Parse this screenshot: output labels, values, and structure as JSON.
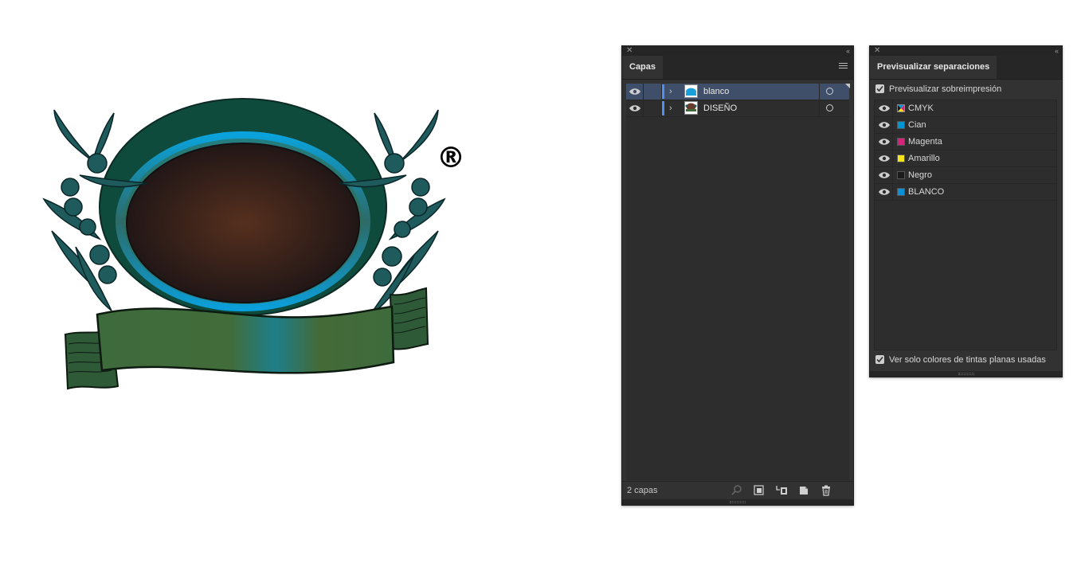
{
  "layers_panel": {
    "tab_label": "Capas",
    "layers": [
      {
        "name": "blanco",
        "selected": true,
        "thumb_color": "#1aa0d8"
      },
      {
        "name": "DISEÑO",
        "selected": false,
        "thumb_color": "#6b3a2a"
      }
    ],
    "footer_count": "2 capas",
    "layer_color": "#4d8ff5"
  },
  "separations_panel": {
    "tab_label": "Previsualizar separaciones",
    "overprint_label": "Previsualizar sobreimpresión",
    "overprint_checked": true,
    "inks": [
      {
        "name": "CMYK",
        "swatch": "cmyk"
      },
      {
        "name": "Cian",
        "swatch": "#0096d6"
      },
      {
        "name": "Magenta",
        "swatch": "#d6247a"
      },
      {
        "name": "Amarillo",
        "swatch": "#f5e51c"
      },
      {
        "name": "Negro",
        "swatch": "#1a1a1a"
      },
      {
        "name": "BLANCO",
        "swatch": "#0a8fd8"
      }
    ],
    "spot_only_label": "Ver solo colores de tintas planas usadas",
    "spot_only_checked": true
  },
  "artwork": {
    "registered_mark": "®",
    "colors": {
      "dark_green": "#0d4a3c",
      "ring_blue": "#0aa6dd",
      "center_brown": "#55291a",
      "banner_green": "#3e6b3c",
      "leaf_teal": "#1f5f60"
    }
  }
}
